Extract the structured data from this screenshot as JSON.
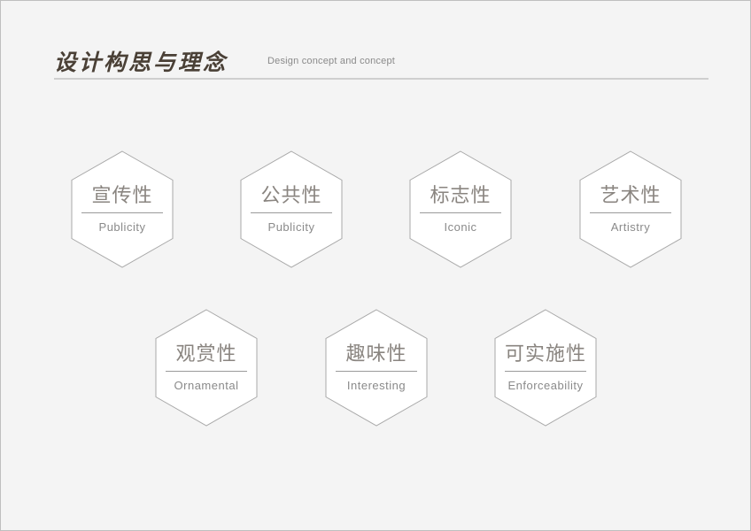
{
  "header": {
    "title": "设计构思与理念",
    "subtitle": "Design  concept and  concept"
  },
  "hexagons": [
    {
      "cn": "宣传性",
      "en": "Publicity"
    },
    {
      "cn": "公共性",
      "en": "Publicity"
    },
    {
      "cn": "标志性",
      "en": "Iconic"
    },
    {
      "cn": "艺术性",
      "en": "Artistry"
    },
    {
      "cn": "观赏性",
      "en": "Ornamental"
    },
    {
      "cn": "趣味性",
      "en": "Interesting"
    },
    {
      "cn": "可实施性",
      "en": "Enforceability"
    }
  ],
  "colors": {
    "background": "#f4f4f4",
    "hex_fill": "#ffffff",
    "hex_stroke": "#a8a8a8",
    "title": "#4a4036",
    "text": "#8a8580"
  }
}
